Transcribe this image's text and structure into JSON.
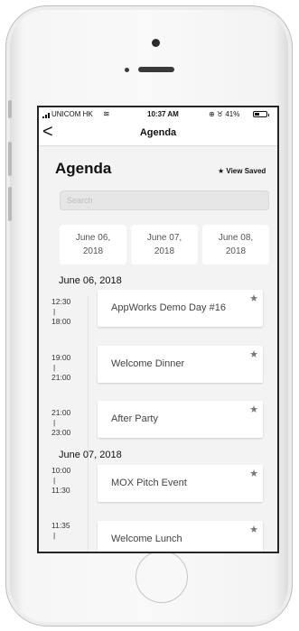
{
  "status_bar": {
    "carrier": "UNICOM HK",
    "time": "10:37 AM",
    "status_icons": "⊕ ♉ 41%",
    "battery_level": 0.41
  },
  "nav": {
    "back_icon": "chevron-left-icon",
    "back_glyph": "<",
    "title": "Agenda"
  },
  "page": {
    "title": "Agenda",
    "view_saved_label": "★ View Saved"
  },
  "search": {
    "placeholder": "Search"
  },
  "date_tabs": [
    "June 06, 2018",
    "June 07, 2018",
    "June 08, 2018"
  ],
  "days": [
    {
      "header": "June 06, 2018",
      "events": [
        {
          "start": "12:30",
          "sep": "|",
          "end": "18:00",
          "title": "AppWorks Demo Day #16"
        },
        {
          "start": "19:00",
          "sep": "|",
          "end": "21:00",
          "title": "Welcome Dinner"
        },
        {
          "start": "21:00",
          "sep": "|",
          "end": "23:00",
          "title": "After Party"
        }
      ]
    },
    {
      "header": "June 07, 2018",
      "events": [
        {
          "start": "10:00",
          "sep": "|",
          "end": "11:30",
          "title": "MOX Pitch Event"
        },
        {
          "start": "11:35",
          "sep": "|",
          "end": "",
          "title": "Welcome Lunch"
        }
      ]
    }
  ],
  "star_glyph": "★",
  "colors": {
    "screen_bg": "#f3f3f3",
    "card_bg": "#ffffff",
    "text": "#111111"
  }
}
